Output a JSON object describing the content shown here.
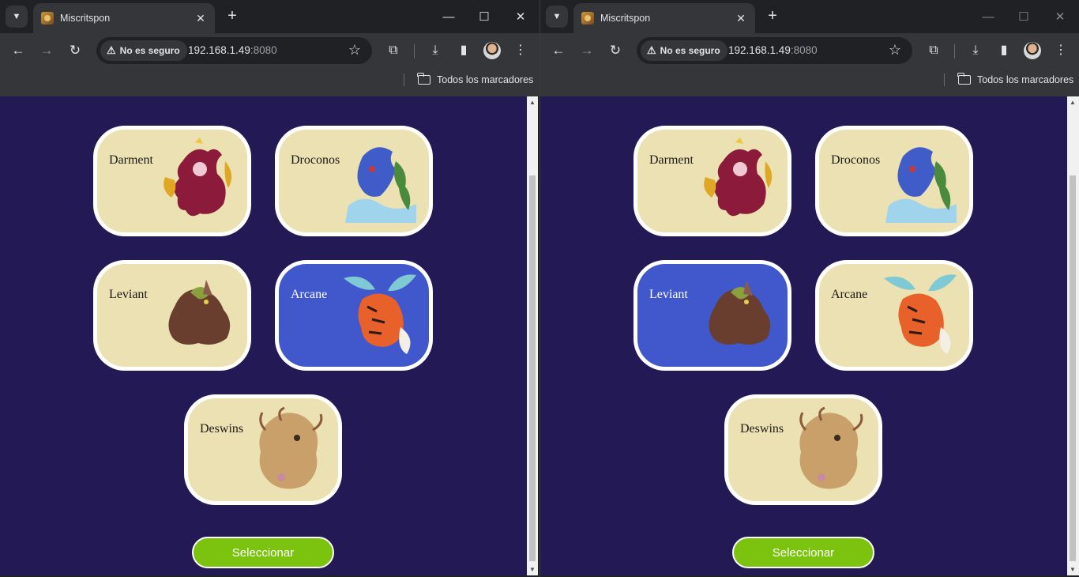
{
  "windows": [
    {
      "tab_title": "Miscritspon",
      "security_label": "No es seguro",
      "url_host": "192.168.1.49",
      "url_port": ":8080",
      "bookmarks_label": "Todos los marcadores",
      "selected_card": "Arcane",
      "button_label": "Seleccionar"
    },
    {
      "tab_title": "Miscritspon",
      "security_label": "No es seguro",
      "url_host": "192.168.1.49",
      "url_port": ":8080",
      "bookmarks_label": "Todos los marcadores",
      "selected_card": "Leviant",
      "button_label": "Seleccionar"
    }
  ],
  "cards": [
    {
      "name": "Darment",
      "icon": "red-dragon-creature"
    },
    {
      "name": "Droconos",
      "icon": "blue-water-dragon-creature"
    },
    {
      "name": "Leviant",
      "icon": "brown-beast-creature"
    },
    {
      "name": "Arcane",
      "icon": "orange-winged-fox-creature"
    },
    {
      "name": "Deswins",
      "icon": "golden-tentacle-creature"
    }
  ],
  "icons": {
    "tab_search": "chevron-down-icon",
    "close_tab": "close-icon",
    "new_tab": "plus-icon",
    "back": "arrow-left-icon",
    "forward": "arrow-right-icon",
    "reload": "reload-icon",
    "warning": "warning-icon",
    "bookmark_star": "star-icon",
    "extensions": "puzzle-icon",
    "downloads": "download-icon",
    "side_panel": "side-panel-icon",
    "menu": "three-dots-icon",
    "folder": "folder-icon"
  },
  "colors": {
    "page_background": "#231a55",
    "card_background": "#ebe1b2",
    "card_selected": "#4058cc",
    "button": "#7cc30f"
  }
}
